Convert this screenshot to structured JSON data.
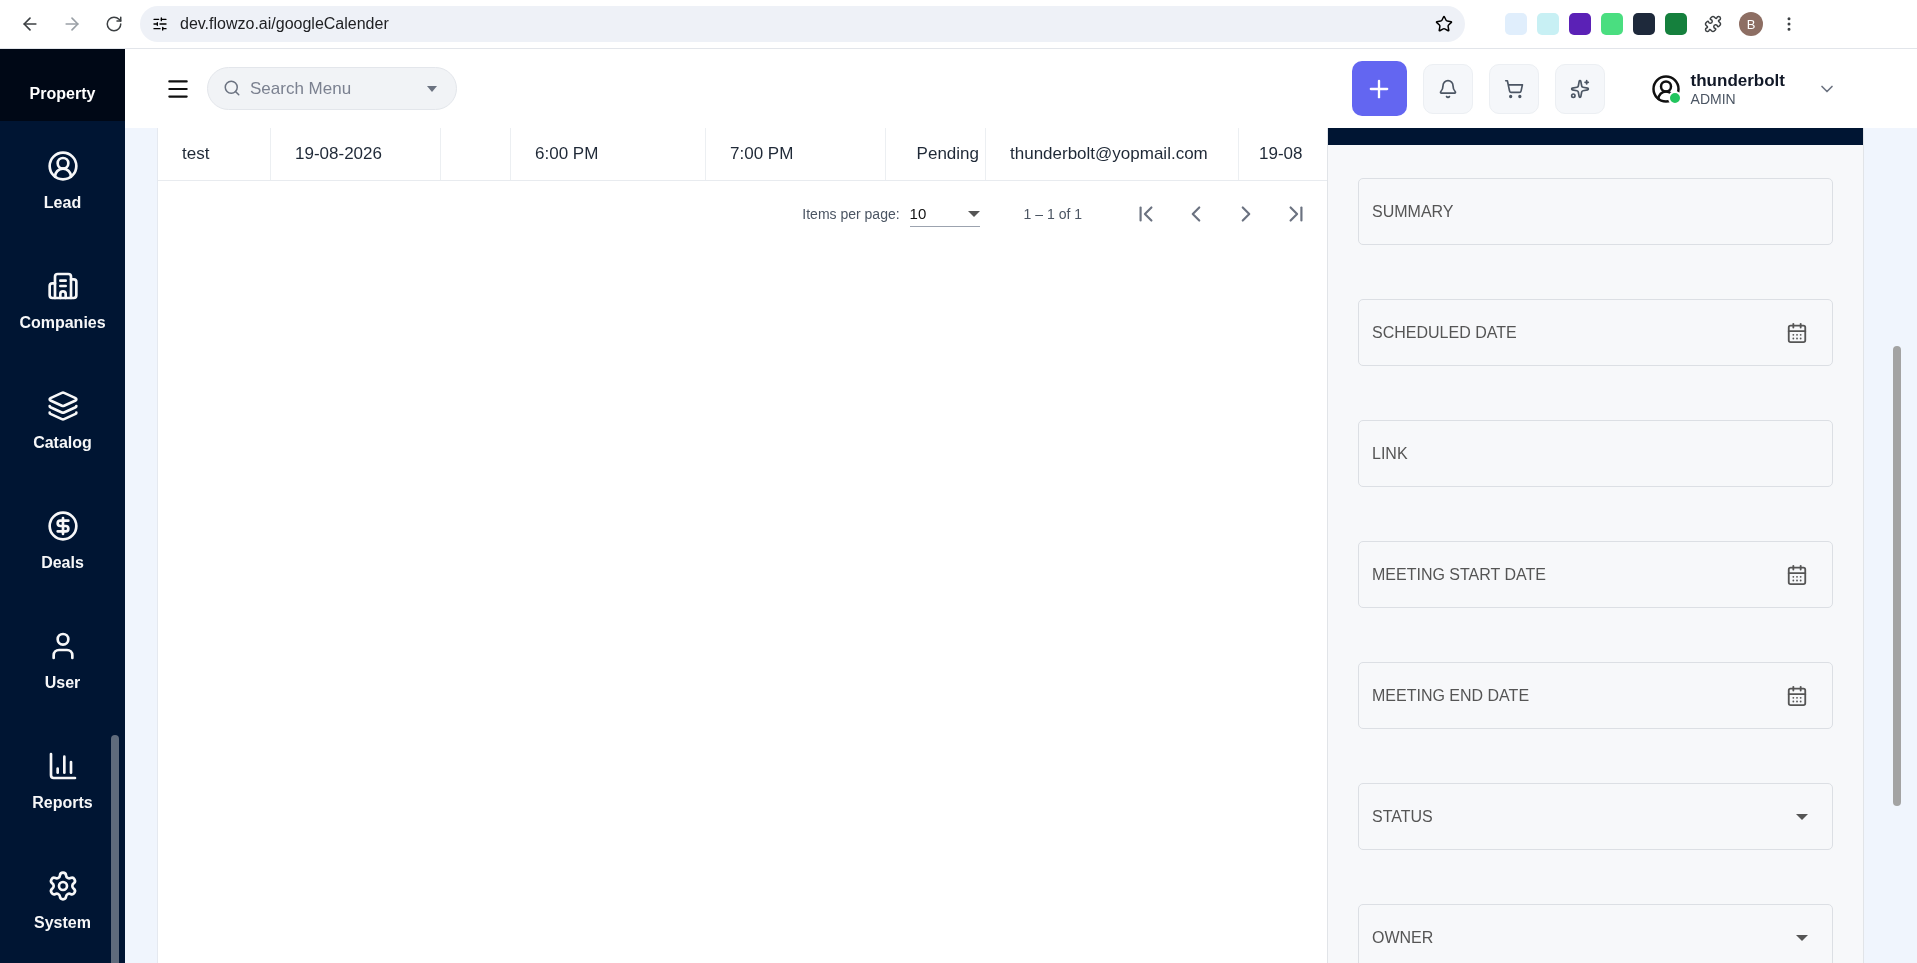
{
  "browser": {
    "url": "dev.flowzo.ai/googleCalender",
    "profile_initial": "B"
  },
  "sidebar": {
    "items": [
      {
        "label": "Property",
        "selected": true
      },
      {
        "label": "Lead",
        "selected": false
      },
      {
        "label": "Companies",
        "selected": false
      },
      {
        "label": "Catalog",
        "selected": false
      },
      {
        "label": "Deals",
        "selected": false
      },
      {
        "label": "User",
        "selected": false
      },
      {
        "label": "Reports",
        "selected": false
      },
      {
        "label": "System",
        "selected": false
      }
    ]
  },
  "header": {
    "search": {
      "placeholder": "Search Menu"
    },
    "user": {
      "name": "thunderbolt",
      "role": "ADMIN"
    }
  },
  "table": {
    "rows": [
      {
        "cells": [
          "test",
          "19-08-2026",
          "6:00 PM",
          "7:00 PM",
          "Pending",
          "thunderbolt@yopmail.com",
          "19-08"
        ]
      }
    ],
    "pagination": {
      "label": "Items per page:",
      "page_size": "10",
      "range": "1 – 1 of 1"
    }
  },
  "form": {
    "fields": [
      {
        "label": "SUMMARY",
        "kind": "text"
      },
      {
        "label": "SCHEDULED DATE",
        "kind": "date"
      },
      {
        "label": "LINK",
        "kind": "text"
      },
      {
        "label": "MEETING START DATE",
        "kind": "date"
      },
      {
        "label": "MEETING END DATE",
        "kind": "date"
      },
      {
        "label": "STATUS",
        "kind": "select"
      },
      {
        "label": "OWNER",
        "kind": "select"
      }
    ]
  }
}
